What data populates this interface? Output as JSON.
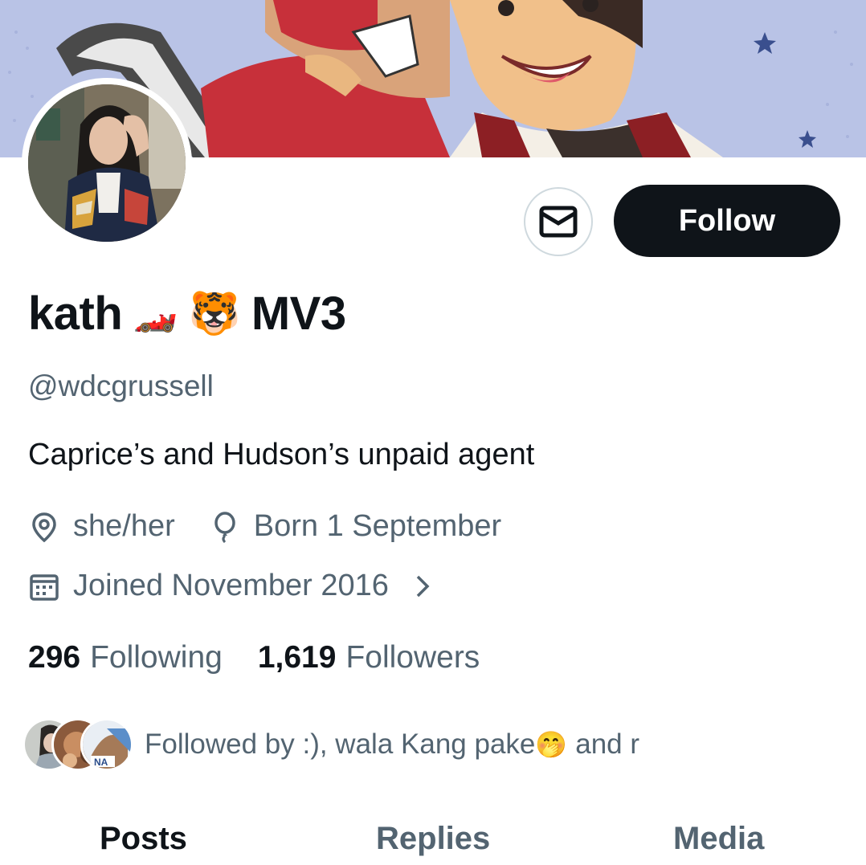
{
  "colors": {
    "accent": "#0f1419",
    "secondary_text": "#536471",
    "border": "#cfd9de",
    "banner_bg": "#b9c3e6"
  },
  "header": {
    "banner_icon": "banner-illustration",
    "avatar_icon": "profile-photo"
  },
  "actions": {
    "message_icon": "envelope-icon",
    "follow_label": "Follow"
  },
  "profile": {
    "name": "kath",
    "name_emoji_1": "🏎️",
    "name_emoji_2": "🐯",
    "name_suffix": "MV3",
    "handle": "@wdcgrussell",
    "bio": "Caprice’s and Hudson’s unpaid agent",
    "location": "she/her",
    "birthday": "Born 1 September",
    "joined": "Joined November 2016"
  },
  "stats": {
    "following_count": "296",
    "following_label": "Following",
    "followers_count": "1,619",
    "followers_label": "Followers"
  },
  "followed_by": {
    "text": "Followed by :), wala Kang pake",
    "emoji": "🤭",
    "text_tail": "and r"
  },
  "tabs": [
    {
      "label": "Posts",
      "active": true
    },
    {
      "label": "Replies",
      "active": false
    },
    {
      "label": "Media",
      "active": false
    }
  ]
}
